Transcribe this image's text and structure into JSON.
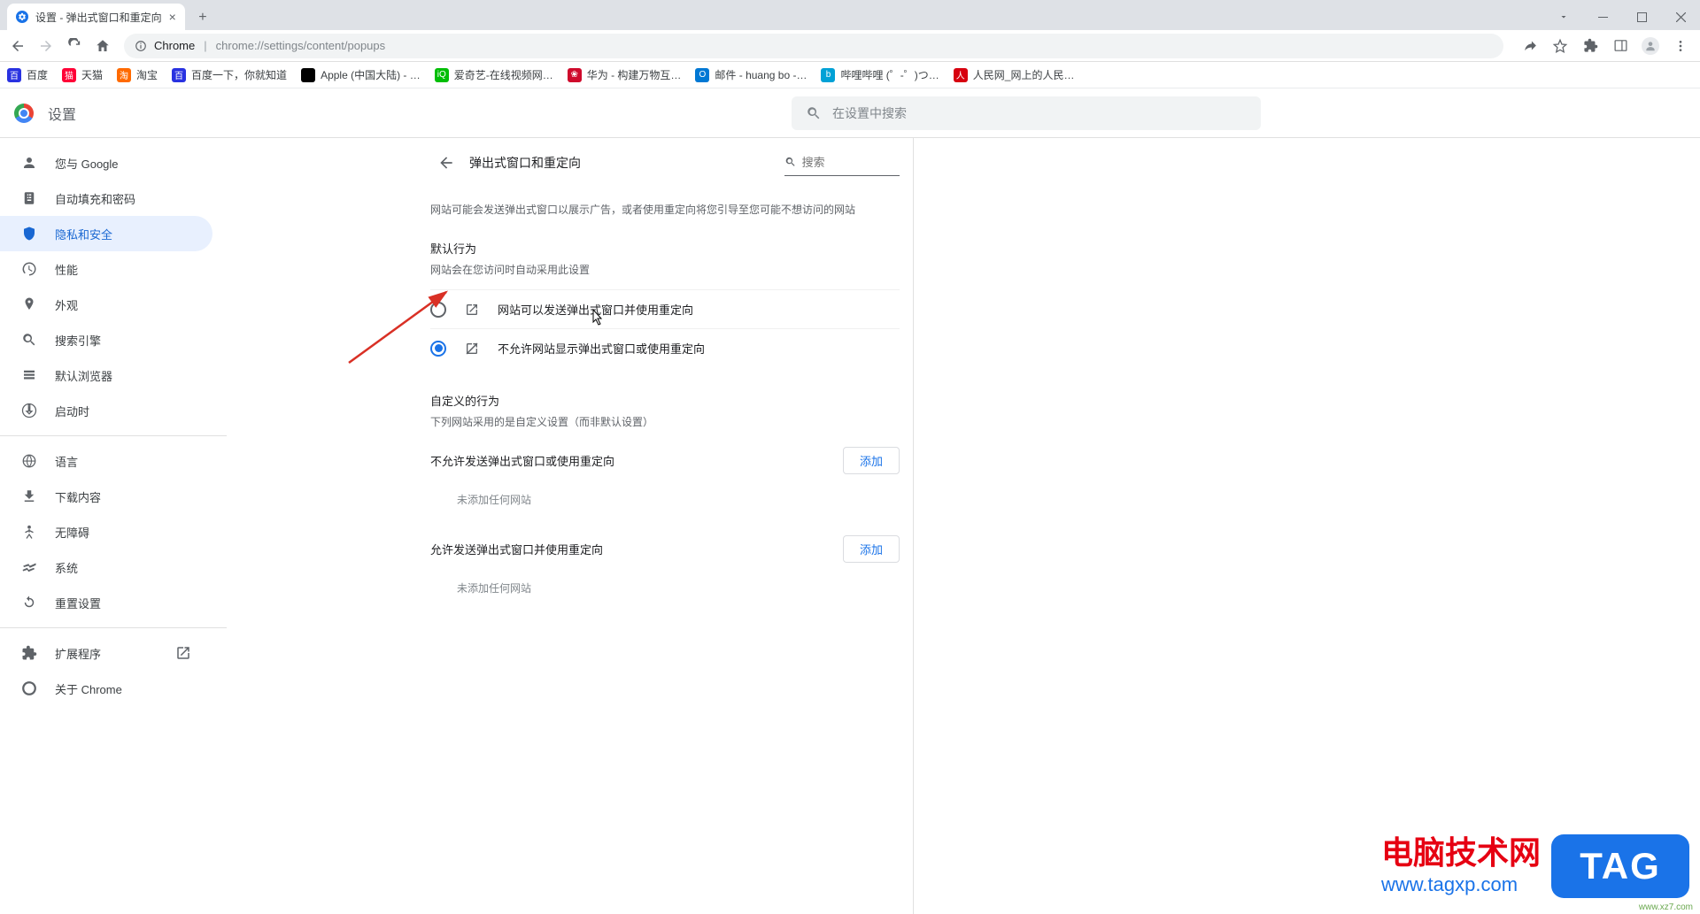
{
  "window": {
    "tab_title": "设置 - 弹出式窗口和重定向"
  },
  "toolbar": {
    "product": "Chrome",
    "url": "chrome://settings/content/popups"
  },
  "bookmarks": [
    {
      "label": "百度",
      "color": "#2932e1",
      "glyph": "百"
    },
    {
      "label": "天猫",
      "color": "#ff0036",
      "glyph": "猫"
    },
    {
      "label": "淘宝",
      "color": "#ff6a00",
      "glyph": "淘"
    },
    {
      "label": "百度一下，你就知道",
      "color": "#2932e1",
      "glyph": "百"
    },
    {
      "label": "Apple (中国大陆) - …",
      "color": "#000000",
      "glyph": ""
    },
    {
      "label": "爱奇艺-在线视频网…",
      "color": "#00be06",
      "glyph": "iQ"
    },
    {
      "label": "华为 - 构建万物互…",
      "color": "#cf0a2c",
      "glyph": "❀"
    },
    {
      "label": "邮件 - huang bo -…",
      "color": "#0078d4",
      "glyph": "O"
    },
    {
      "label": "哔哩哔哩 (゜-゜)つ…",
      "color": "#00a1d6",
      "glyph": "b"
    },
    {
      "label": "人民网_网上的人民…",
      "color": "#d7000f",
      "glyph": "人"
    }
  ],
  "settings": {
    "title": "设置",
    "search_placeholder": "在设置中搜索"
  },
  "sidebar": {
    "items": [
      {
        "label": "您与 Google"
      },
      {
        "label": "自动填充和密码"
      },
      {
        "label": "隐私和安全"
      },
      {
        "label": "性能"
      },
      {
        "label": "外观"
      },
      {
        "label": "搜索引擎"
      },
      {
        "label": "默认浏览器"
      },
      {
        "label": "启动时"
      },
      {
        "label": "语言"
      },
      {
        "label": "下载内容"
      },
      {
        "label": "无障碍"
      },
      {
        "label": "系统"
      },
      {
        "label": "重置设置"
      },
      {
        "label": "扩展程序"
      },
      {
        "label": "关于 Chrome"
      }
    ]
  },
  "panel": {
    "title": "弹出式窗口和重定向",
    "search_placeholder": "搜索",
    "description": "网站可能会发送弹出式窗口以展示广告，或者使用重定向将您引导至您可能不想访问的网站",
    "default_behavior_title": "默认行为",
    "default_behavior_sub": "网站会在您访问时自动采用此设置",
    "option_allow": "网站可以发送弹出式窗口并使用重定向",
    "option_block": "不允许网站显示弹出式窗口或使用重定向",
    "custom_title": "自定义的行为",
    "custom_sub": "下列网站采用的是自定义设置（而非默认设置）",
    "block_list_title": "不允许发送弹出式窗口或使用重定向",
    "allow_list_title": "允许发送弹出式窗口并使用重定向",
    "add_button": "添加",
    "empty_text": "未添加任何网站"
  },
  "watermark": {
    "line1": "电脑技术网",
    "line2": "www.tagxp.com",
    "tag": "TAG",
    "small": "www.xz7.com"
  }
}
